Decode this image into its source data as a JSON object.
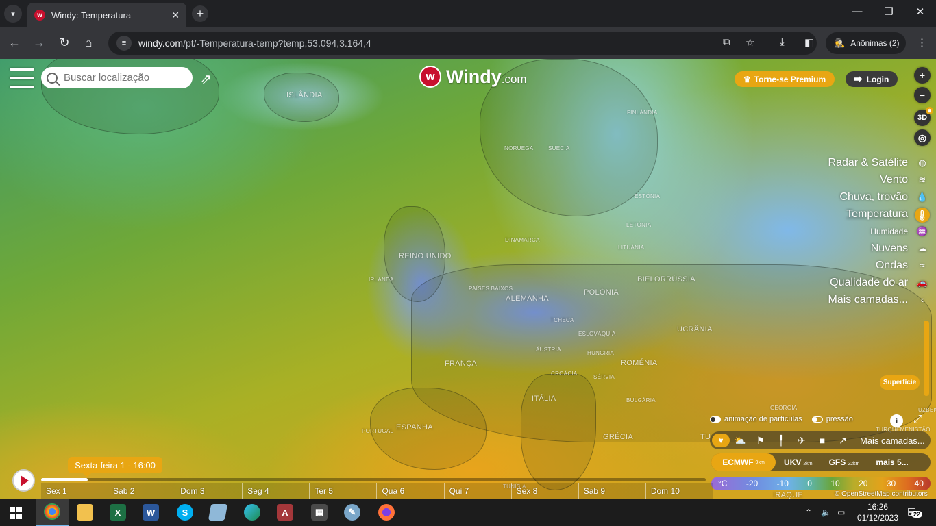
{
  "browser": {
    "tab_title": "Windy: Temperatura",
    "tab_favicon": "windy-logo-icon",
    "url_host": "windy.com",
    "url_path": "/pt/-Temperatura-temp?temp,53.094,3.164,4",
    "incognito_label": "Anônimas (2)"
  },
  "map": {
    "search_placeholder": "Buscar localização",
    "logo_main": "Windy",
    "logo_suffix": ".com",
    "premium_label": "Torne-se Premium",
    "login_label": "Login",
    "btn_3d": "3D",
    "countries": {
      "islandia": "ISLÂNDIA",
      "noruega": "NORUEGA",
      "suecia": "SUECIA",
      "finlandia": "FINLÂNDIA",
      "estonia": "ESTÓNIA",
      "letonia": "LETÓNIA",
      "lituania": "LITUÂNIA",
      "dinamarca": "DINAMARCA",
      "reino_unido": "REINO UNIDO",
      "irlanda": "IRLANDA",
      "paises_baixos": "PAÍSES BAIXOS",
      "alemanha": "ALEMANHA",
      "polonia": "POLÓNIA",
      "bielorrussia": "BIELORRÚSSIA",
      "ucrania": "UCRÂNIA",
      "tchecia": "TCHECA",
      "eslovaquia": "ESLOVÁQUIA",
      "austria": "ÁUSTRIA",
      "hungria": "HUNGRIA",
      "romenia": "ROMÉNIA",
      "franca": "FRANÇA",
      "croacia": "CROÁCIA",
      "servia": "SÉRVIA",
      "bulgaria": "BULGÁRIA",
      "italia": "ITÁLIA",
      "espanha": "ESPANHA",
      "portugal": "PORTUGAL",
      "grecia": "GRÉCIA",
      "georgia": "GEORGIA",
      "turquemenistao": "TURQUEMENISTÃO",
      "uzbek": "UZBEK",
      "turquia": "TU",
      "iraque": "IRAQUE",
      "tunisia": "TUNÍSIA"
    },
    "layers": [
      {
        "label": "Radar & Satélite",
        "icon": "globe-icon",
        "active": false
      },
      {
        "label": "Vento",
        "icon": "wind-icon",
        "active": false
      },
      {
        "label": "Chuva, trovão",
        "icon": "raindrop-icon",
        "active": false
      },
      {
        "label": "Temperatura",
        "icon": "thermometer-icon",
        "active": true
      },
      {
        "label": "Humidade",
        "icon": "humidity-icon",
        "active": false
      },
      {
        "label": "Nuvens",
        "icon": "cloud-icon",
        "active": false
      },
      {
        "label": "Ondas",
        "icon": "waves-icon",
        "active": false
      },
      {
        "label": "Qualidade do ar",
        "icon": "car-icon",
        "active": false
      },
      {
        "label": "Mais camadas...",
        "icon": "chevron-left-icon",
        "active": false
      }
    ],
    "surface_label": "Superfície",
    "particle_toggle": "animação de partículas",
    "pressure_toggle": "pressão",
    "overlay_more": "Mais camadas...",
    "models": [
      {
        "name": "ECMWF",
        "res": "9km",
        "selected": true
      },
      {
        "name": "UKV",
        "res": "2km",
        "selected": false
      },
      {
        "name": "GFS",
        "res": "22km",
        "selected": false
      }
    ],
    "models_more": "mais 5...",
    "legend_unit": "°C",
    "legend_values": [
      "-20",
      "-10",
      "0",
      "10",
      "20",
      "30",
      "40"
    ],
    "attribution": "© OpenStreetMap contributors",
    "time_label": "Sexta-feira 1 - 16:00",
    "timeline_progress": 0.07,
    "days": [
      "Sex 1",
      "Sab 2",
      "Dom 3",
      "Seg 4",
      "Ter 5",
      "Qua 6",
      "Qui 7",
      "Sex 8",
      "Sab 9",
      "Dom 10"
    ]
  },
  "taskbar": {
    "time": "16:26",
    "date": "01/12/2023",
    "notification_count": "22"
  },
  "colors": {
    "accent": "#e8a613",
    "windy_red": "#c8102e"
  }
}
